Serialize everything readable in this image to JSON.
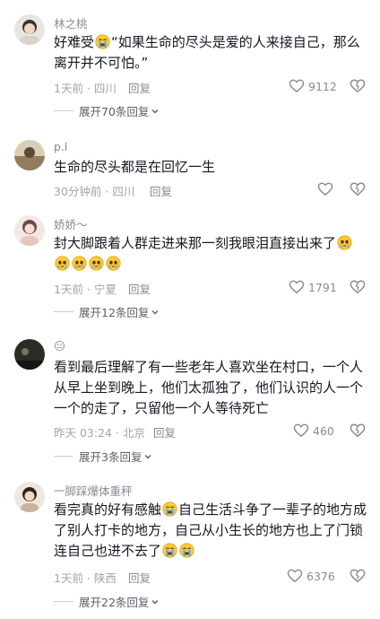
{
  "comments": [
    {
      "user": "林之桃",
      "text_a": "好难受",
      "text_b": "“如果生命的尽头是爱的人来接自己，那么离开并不可怕。”",
      "meta": "1天前 · 四川",
      "reply": "回复",
      "likes": "9112",
      "expand": "展开70条回复"
    },
    {
      "user": "p.l",
      "text": "生命的尽头都是在回忆一生",
      "meta": "30分钟前 · 四川",
      "reply": "回复"
    },
    {
      "user": "娇娇～",
      "text": "封大脚跟着人群走进来那一刻我眼泪直接出来了",
      "meta": "1天前 · 宁夏",
      "reply": "回复",
      "likes": "1791",
      "expand": "展开12条回复"
    },
    {
      "user": "😑",
      "text": "看到最后理解了有一些老年人喜欢坐在村口，一个人从早上坐到晚上，他们太孤独了，他们认识的人一个一个的走了，只留他一个人等待死亡",
      "meta": "昨天 03:24 · 北京",
      "reply": "回复",
      "likes": "460",
      "expand": "展开3条回复"
    },
    {
      "user": "一脚踩爆体重秤",
      "text_a": "看完真的好有感触",
      "text_b": "自己生活斗争了一辈子的地方成了别人打卡的地方，自己从小生长的地方也上了门锁连自己也进不去了",
      "meta": "1天前 · 陕西",
      "reply": "回复",
      "likes": "6376",
      "expand": "展开22条回复"
    }
  ],
  "icons": {
    "like": "heart-outline-icon",
    "dislike": "broken-heart-icon",
    "expand": "chevron-down-icon",
    "emoji_cry": "loudly-crying-face-icon",
    "emoji_tear": "pleading-face-icon"
  },
  "colors": {
    "text": "#161823",
    "secondary": "#8a8b91",
    "muted": "#a3a4aa",
    "emoji": "#ffcb3d"
  }
}
